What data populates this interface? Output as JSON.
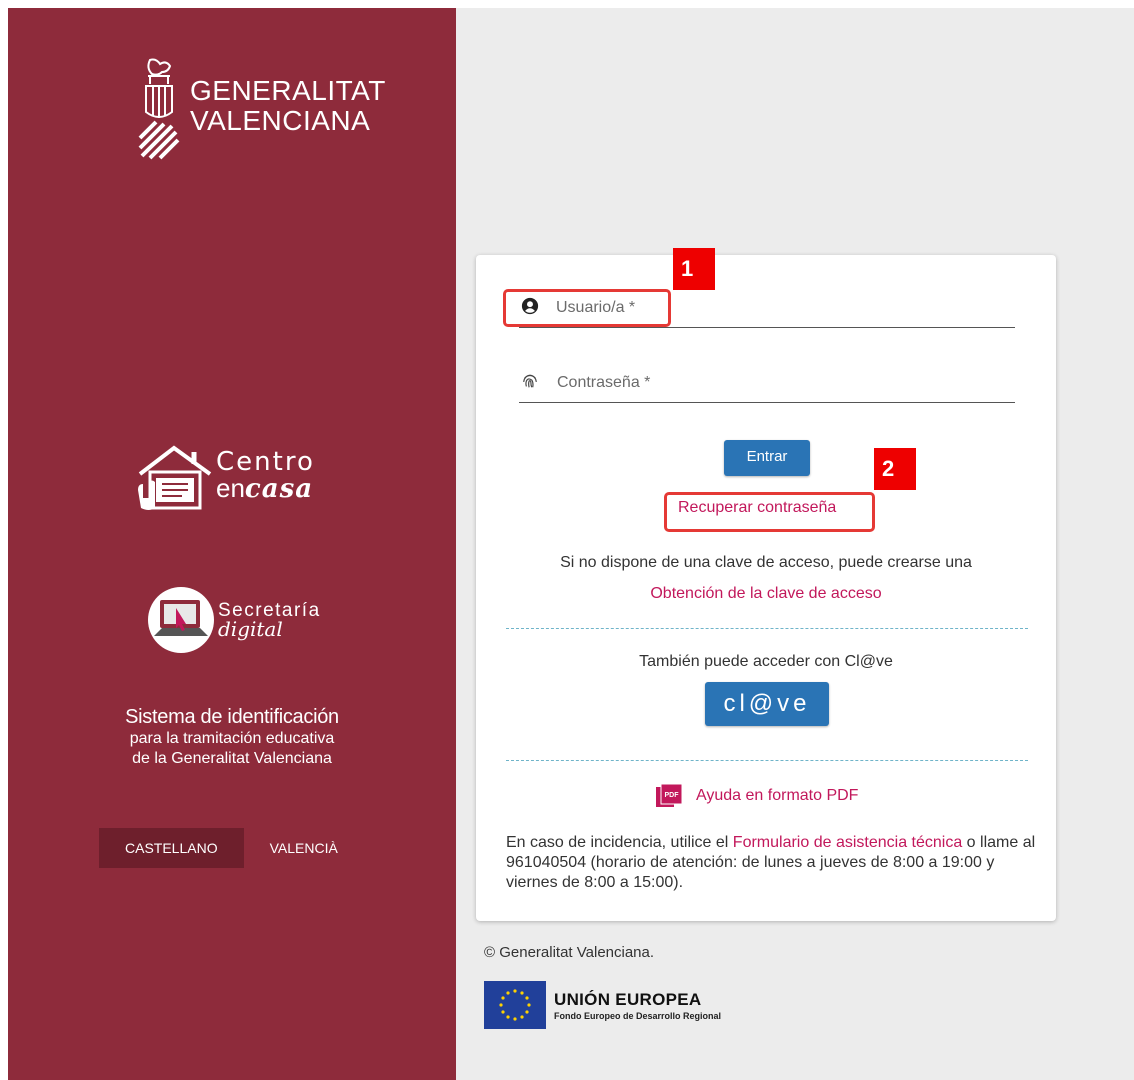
{
  "brand": {
    "name_line1": "GENERALITAT",
    "name_line2": "VALENCIANA"
  },
  "centro_en_casa": {
    "line1": "Centro",
    "line2_a": "en",
    "line2_b": "casa"
  },
  "secretaria": {
    "line1": "Secretaría",
    "line2": "digital"
  },
  "system": {
    "title": "Sistema de identificación",
    "subtitle_line1": "para la tramitación educativa",
    "subtitle_line2": "de la Generalitat Valenciana"
  },
  "languages": [
    {
      "label": "CASTELLANO",
      "active": true
    },
    {
      "label": "VALENCIÀ",
      "active": false
    }
  ],
  "form": {
    "user_label": "Usuario/a *",
    "password_label": "Contraseña *",
    "submit_label": "Entrar",
    "recover_link": "Recuperar contraseña",
    "no_key_text": "Si no dispone de una clave de acceso, puede crearse una",
    "obtain_key_link": "Obtención de la clave de acceso",
    "clave_text": "También puede acceder con Cl@ve",
    "clave_button": "cl@ve",
    "help_pdf_link": "Ayuda en formato PDF",
    "incidence_prefix": "En caso de incidencia, utilice el ",
    "incidence_link": "Formulario de asistencia técnica",
    "incidence_suffix": " o llame al 961040504 (horario de atención: de lunes a jueves de 8:00 a 19:00 y viernes de 8:00 a 15:00)."
  },
  "annotations": {
    "badge1": "1",
    "badge2": "2"
  },
  "footer": {
    "copyright": "© Generalitat Valenciana.",
    "eu_title": "UNIÓN EUROPEA",
    "eu_subtitle": "Fondo Europeo de Desarrollo Regional"
  },
  "icons": {
    "user": "user-circle-icon",
    "password": "fingerprint-icon",
    "pdf": "pdf-icon"
  },
  "colors": {
    "brand_maroon": "#8e2b3b",
    "button_blue": "#2a74b5",
    "link_pink": "#c2185b",
    "highlight_red": "#e53935"
  }
}
